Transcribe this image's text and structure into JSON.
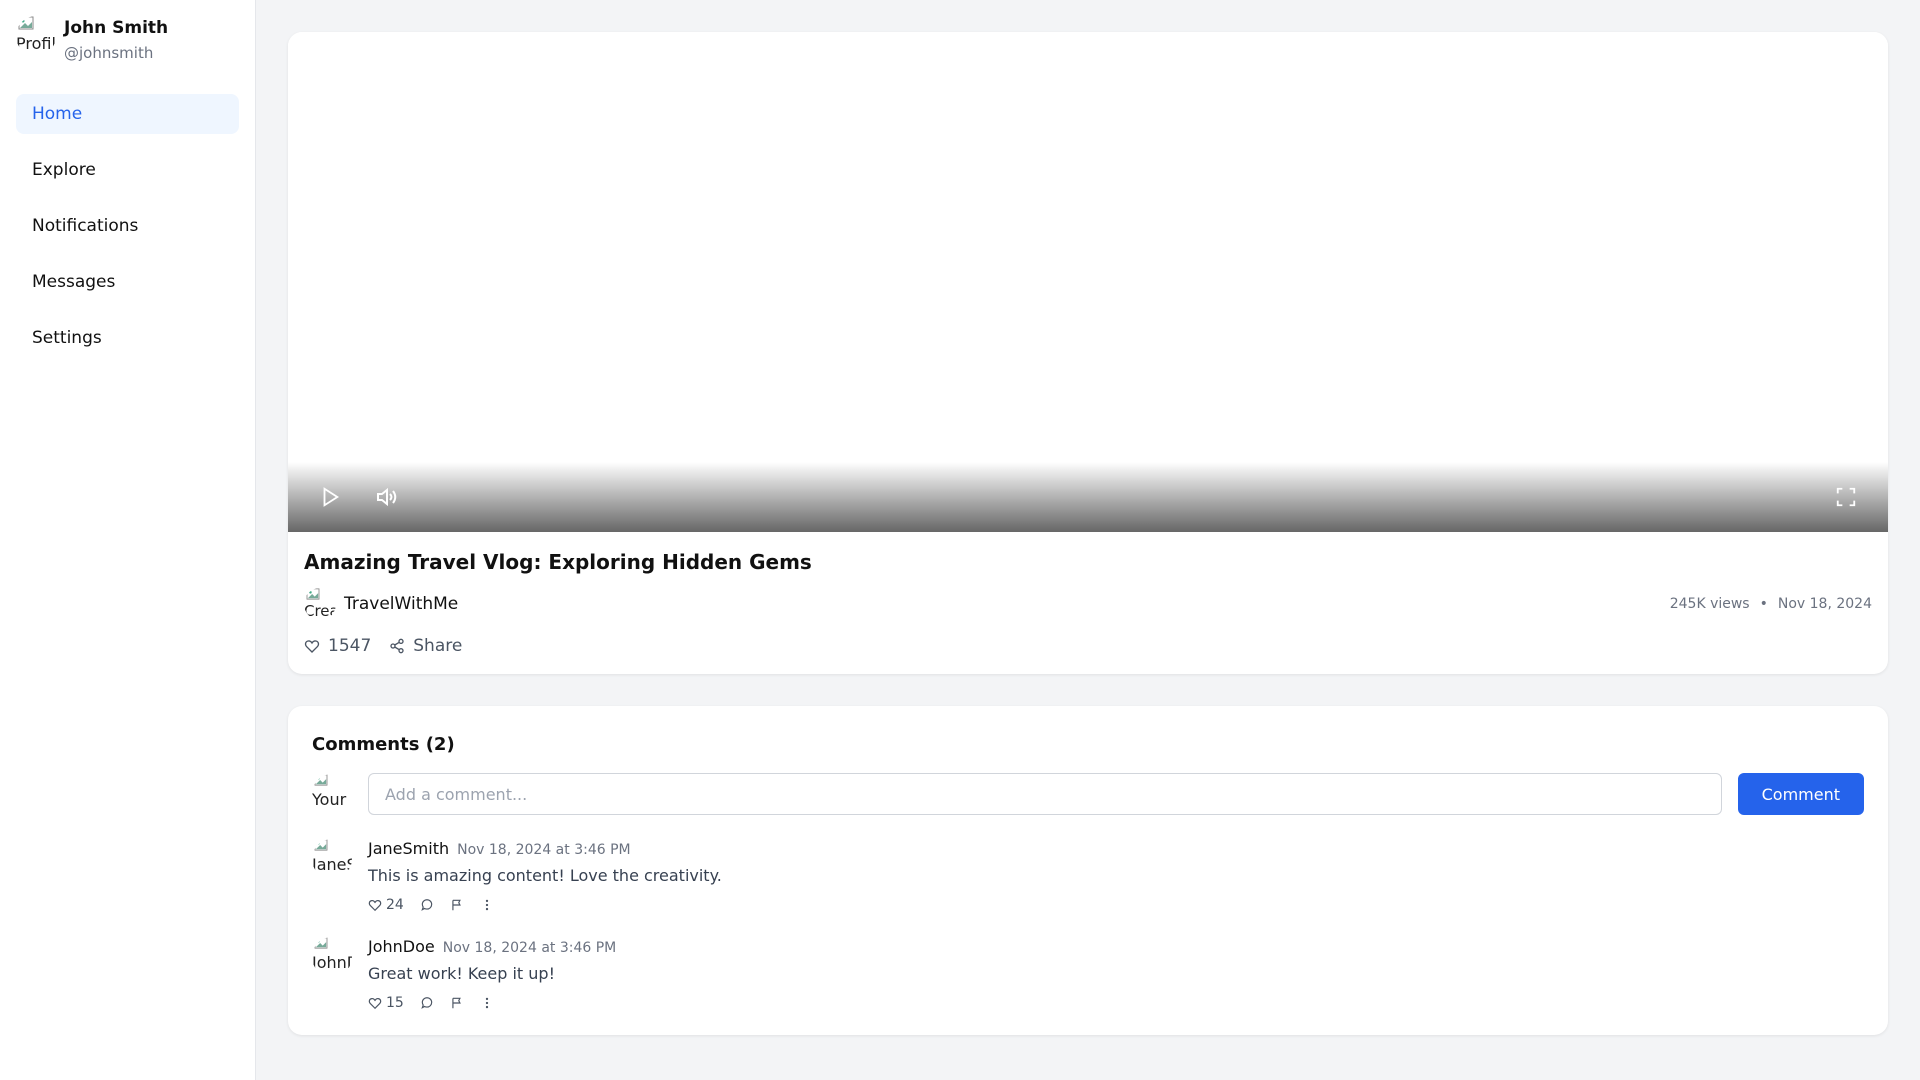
{
  "user": {
    "name": "John Smith",
    "handle": "@johnsmith",
    "avatar_alt": "Profile"
  },
  "sidebar": {
    "items": [
      {
        "label": "Home",
        "active": true
      },
      {
        "label": "Explore"
      },
      {
        "label": "Notifications"
      },
      {
        "label": "Messages"
      },
      {
        "label": "Settings"
      }
    ]
  },
  "video": {
    "title": "Amazing Travel Vlog: Exploring Hidden Gems",
    "creator": "TravelWithMe",
    "creator_avatar_alt": "Creator",
    "views": "245K views",
    "separator": "•",
    "date": "Nov 18, 2024",
    "likes": "1547",
    "share_label": "Share",
    "icons": [
      "play-icon",
      "volume-icon",
      "fullscreen-icon",
      "heart-icon",
      "share-icon"
    ]
  },
  "comments": {
    "title": "Comments (2)",
    "your_avatar_alt": "Your",
    "input_placeholder": "Add a comment...",
    "submit_label": "Comment",
    "items": [
      {
        "author": "JaneSmith",
        "avatar_alt": "JaneSmith",
        "time": "Nov 18, 2024 at 3:46 PM",
        "text": "This is amazing content! Love the creativity.",
        "likes": "24"
      },
      {
        "author": "JohnDoe",
        "avatar_alt": "JohnDoe",
        "time": "Nov 18, 2024 at 3:46 PM",
        "text": "Great work! Keep it up!",
        "likes": "15"
      }
    ]
  },
  "colors": {
    "accent": "#2563eb",
    "active_bg": "#eff6ff",
    "page_bg": "#f3f4f6"
  }
}
